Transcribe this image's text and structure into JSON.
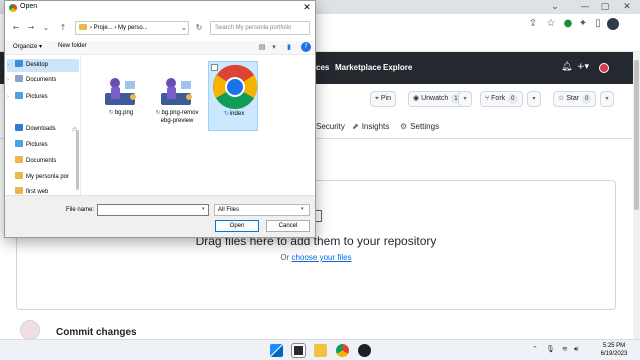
{
  "browser": {
    "window_controls": [
      "⌄",
      "—",
      "▢",
      "✕"
    ],
    "toolbar_icons": [
      "share-icon",
      "star-icon",
      "extension-icon",
      "puzzle-icon",
      "sidebar-icon"
    ]
  },
  "github": {
    "nav": [
      "ces",
      "Marketplace",
      "Explore"
    ],
    "header_icons": [
      "bell-icon",
      "plus-icon",
      "avatar"
    ],
    "repo_buttons": {
      "pin": "Pin",
      "unwatch": "Unwatch",
      "unwatch_count": "1",
      "fork": "Fork",
      "fork_count": "0",
      "star": "Star",
      "star_count": "0"
    },
    "tabs": [
      "Security",
      "Insights",
      "Settings"
    ],
    "upload": {
      "title": "Drag files here to add them to your repository",
      "or_text": "Or",
      "choose_link": "choose your files"
    },
    "commit_title": "Commit changes"
  },
  "dialog": {
    "title": "Open",
    "breadcrumb": [
      "Proje...",
      "My perso..."
    ],
    "search_placeholder": "Search My personla portfolio",
    "organize": "Organize",
    "new_folder": "New folder",
    "sidebar": [
      {
        "label": "Desktop",
        "icon": "desktop-icon",
        "selected": true
      },
      {
        "label": "Documents",
        "icon": "documents-icon"
      },
      {
        "label": "Pictures",
        "icon": "pictures-icon"
      },
      {
        "label": "Downloads",
        "icon": "downloads-icon"
      },
      {
        "label": "Pictures",
        "icon": "pictures-icon"
      },
      {
        "label": "Documents",
        "icon": "documents-icon"
      },
      {
        "label": "My personla por",
        "icon": "folder-icon"
      },
      {
        "label": "first web",
        "icon": "folder-icon"
      }
    ],
    "files": [
      {
        "name": "bg.png"
      },
      {
        "name": "bg.png-remov ebg-preview"
      },
      {
        "name": "index",
        "selected": true
      }
    ],
    "file_name_label": "File name:",
    "file_name_value": "",
    "file_type": "All Files",
    "open_button": "Open",
    "cancel_button": "Cancel"
  },
  "taskbar": {
    "time": "5:25 PM",
    "date": "6/19/2023",
    "apps": [
      "windows-icon",
      "file-explorer-icon",
      "folder-icon",
      "chrome-icon",
      "github-desktop-icon"
    ]
  }
}
